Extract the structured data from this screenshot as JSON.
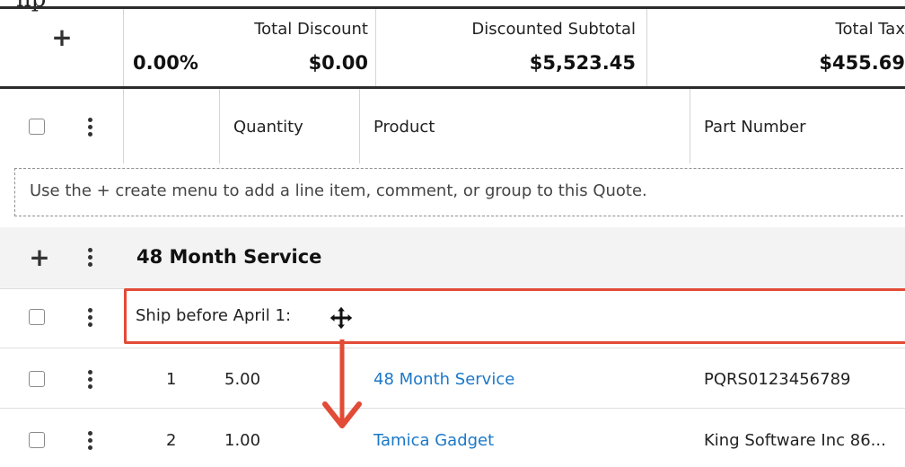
{
  "top_cut_text": "np",
  "totals": {
    "add_label": "+",
    "discount_percent": "0.00%",
    "total_discount_label": "Total Discount",
    "total_discount_value": "$0.00",
    "discounted_subtotal_label": "Discounted Subtotal",
    "discounted_subtotal_value": "$5,523.45",
    "total_tax_label": "Total Tax",
    "total_tax_value": "$455.69"
  },
  "columns": {
    "quantity": "Quantity",
    "product": "Product",
    "part_number": "Part Number"
  },
  "empty_message": "Use the + create menu to add a line item, comment, or group to this Quote.",
  "group": {
    "add_label": "+",
    "title": "48 Month Service"
  },
  "comment": {
    "text": "Ship before April 1:"
  },
  "line_items": [
    {
      "row_number": "1",
      "quantity": "5.00",
      "product": "48 Month Service",
      "part_number": "PQRS0123456789"
    },
    {
      "row_number": "2",
      "quantity": "1.00",
      "product": "Tamica Gadget",
      "part_number": "King Software Inc 86..."
    }
  ],
  "colors": {
    "highlight": "#e24b36",
    "link": "#1b78c8",
    "group_background": "#f3f3f3"
  },
  "icons": [
    "plus-icon",
    "kebab-menu-icon",
    "checkbox-icon",
    "move-cursor-icon",
    "arrow-down-icon"
  ]
}
